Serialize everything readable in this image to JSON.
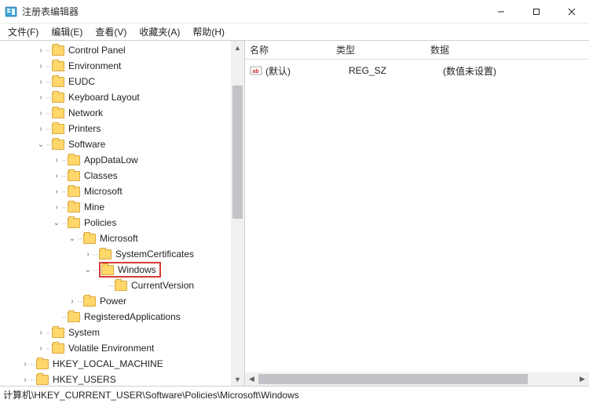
{
  "window": {
    "title": "注册表编辑器"
  },
  "menu": {
    "file": "文件(F)",
    "edit": "编辑(E)",
    "view": "查看(V)",
    "favorites": "收藏夹(A)",
    "help": "帮助(H)"
  },
  "tree": [
    {
      "indent": 2,
      "expand": "col",
      "label": "Control Panel"
    },
    {
      "indent": 2,
      "expand": "col",
      "label": "Environment"
    },
    {
      "indent": 2,
      "expand": "col",
      "label": "EUDC"
    },
    {
      "indent": 2,
      "expand": "col",
      "label": "Keyboard Layout"
    },
    {
      "indent": 2,
      "expand": "col",
      "label": "Network"
    },
    {
      "indent": 2,
      "expand": "col",
      "label": "Printers"
    },
    {
      "indent": 2,
      "expand": "exp",
      "label": "Software"
    },
    {
      "indent": 3,
      "expand": "col",
      "label": "AppDataLow"
    },
    {
      "indent": 3,
      "expand": "col",
      "label": "Classes"
    },
    {
      "indent": 3,
      "expand": "col",
      "label": "Microsoft"
    },
    {
      "indent": 3,
      "expand": "col",
      "label": "Mine"
    },
    {
      "indent": 3,
      "expand": "exp",
      "label": "Policies"
    },
    {
      "indent": 4,
      "expand": "exp",
      "label": "Microsoft"
    },
    {
      "indent": 5,
      "expand": "col",
      "label": "SystemCertificates"
    },
    {
      "indent": 5,
      "expand": "exp",
      "label": "Windows",
      "highlight": true
    },
    {
      "indent": 6,
      "expand": "none",
      "label": "CurrentVersion"
    },
    {
      "indent": 4,
      "expand": "col",
      "label": "Power"
    },
    {
      "indent": 3,
      "expand": "none",
      "label": "RegisteredApplications"
    },
    {
      "indent": 2,
      "expand": "col",
      "label": "System"
    },
    {
      "indent": 2,
      "expand": "col",
      "label": "Volatile Environment"
    },
    {
      "indent": 1,
      "expand": "col",
      "label": "HKEY_LOCAL_MACHINE"
    },
    {
      "indent": 1,
      "expand": "col",
      "label": "HKEY_USERS"
    }
  ],
  "list": {
    "columns": {
      "name": "名称",
      "type": "类型",
      "data": "数据"
    },
    "rows": [
      {
        "name": "(默认)",
        "type": "REG_SZ",
        "data": "(数值未设置)"
      }
    ]
  },
  "status": {
    "path": "计算机\\HKEY_CURRENT_USER\\Software\\Policies\\Microsoft\\Windows"
  }
}
